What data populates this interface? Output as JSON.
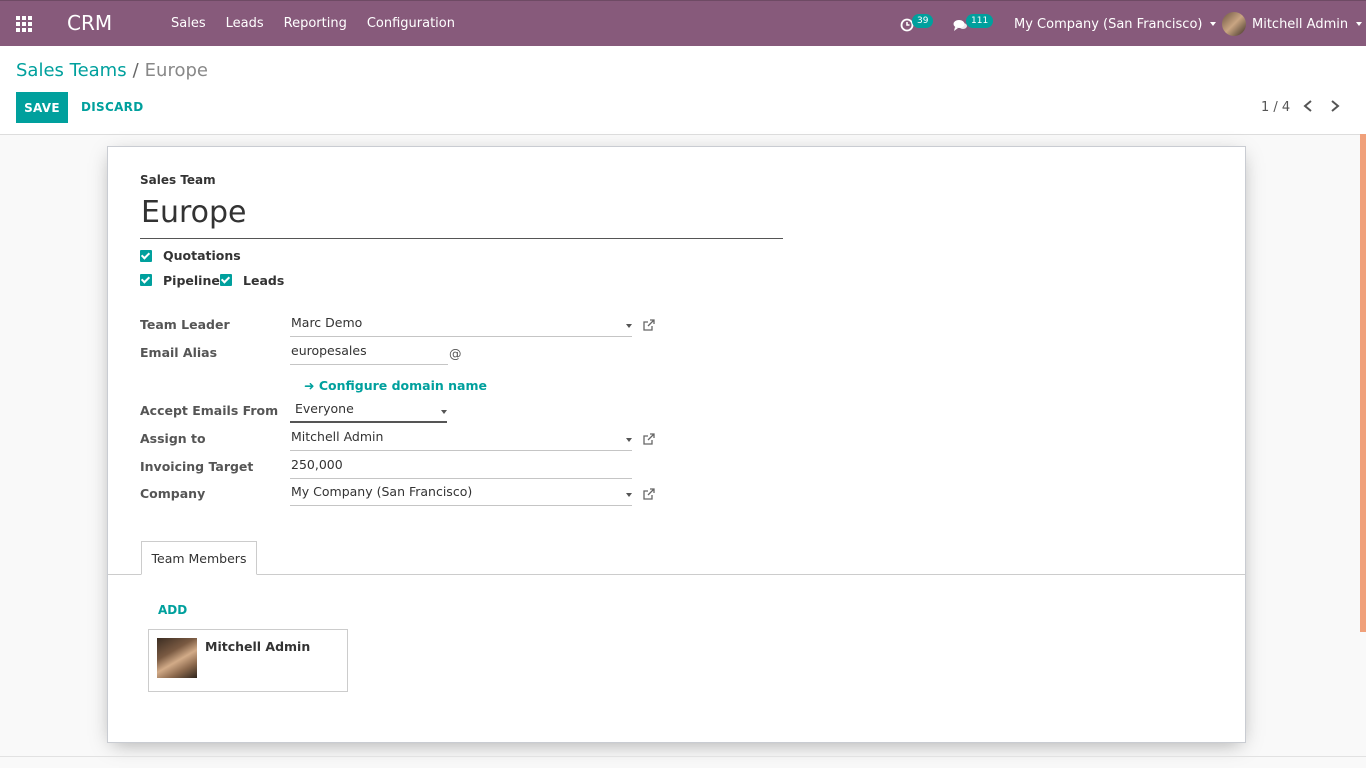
{
  "navbar": {
    "brand": "CRM",
    "menu": [
      "Sales",
      "Leads",
      "Reporting",
      "Configuration"
    ],
    "activity_count": "39",
    "message_count": "111",
    "company": "My Company (San Francisco)",
    "user": "Mitchell Admin"
  },
  "control": {
    "breadcrumb_parent": "Sales Teams",
    "breadcrumb_sep": "/",
    "breadcrumb_current": "Europe",
    "save_label": "SAVE",
    "discard_label": "DISCARD",
    "pager": "1 / 4"
  },
  "form": {
    "title_label": "Sales Team",
    "name": "Europe",
    "checkboxes": {
      "quotations": "Quotations",
      "pipeline": "Pipeline",
      "leads": "Leads"
    },
    "fields": {
      "team_leader_label": "Team Leader",
      "team_leader": "Marc Demo",
      "email_alias_label": "Email Alias",
      "email_alias": "europesales",
      "at_sign": "@",
      "configure_domain": "Configure domain name",
      "accept_emails_label": "Accept Emails From",
      "accept_emails": "Everyone",
      "assign_to_label": "Assign to",
      "assign_to": "Mitchell Admin",
      "invoicing_target_label": "Invoicing Target",
      "invoicing_target": "250,000",
      "company_label": "Company",
      "company": "My Company (San Francisco)"
    },
    "tab_label": "Team Members",
    "add_label": "ADD",
    "member_name": "Mitchell Admin"
  },
  "colors": {
    "navbar": "#875a7b",
    "accent": "#00a09d"
  }
}
